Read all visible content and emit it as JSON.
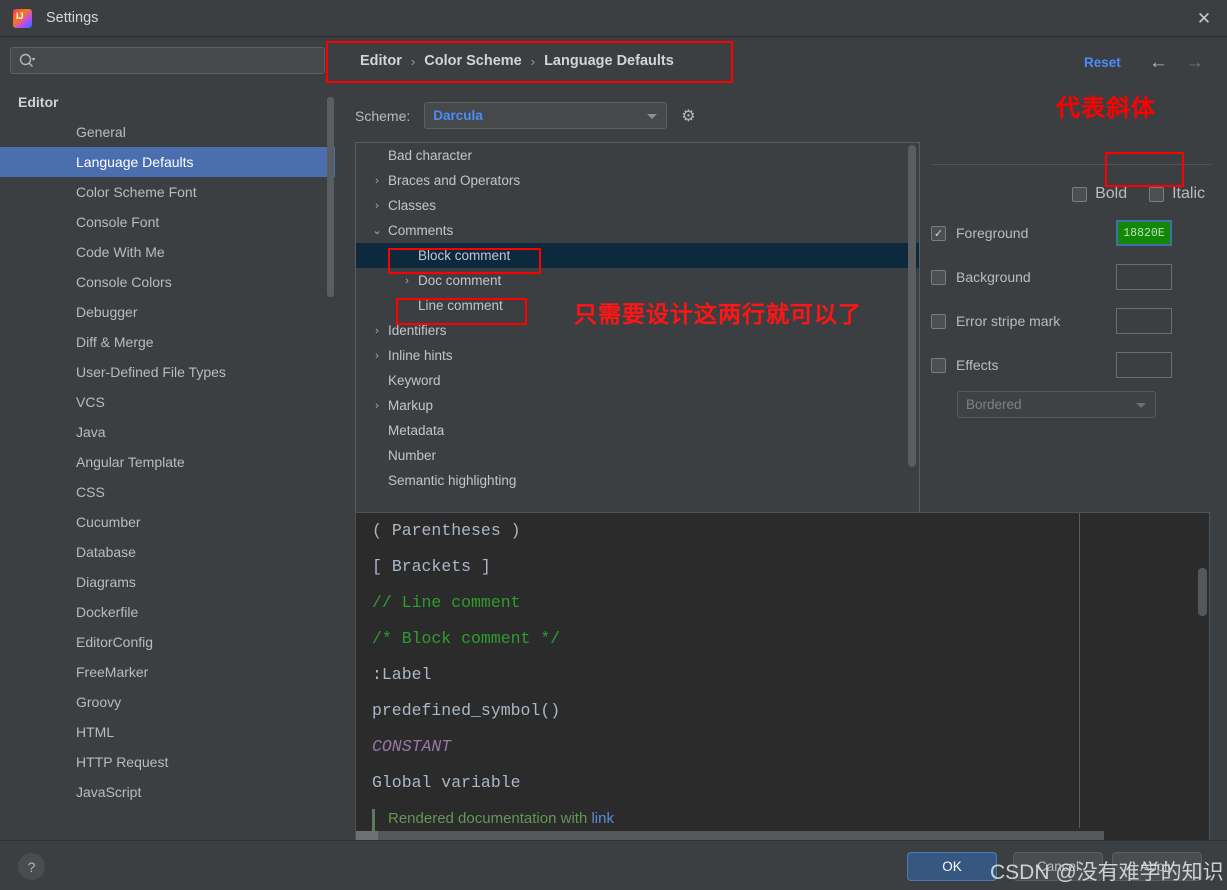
{
  "window": {
    "title": "Settings",
    "logo_icon": "intellij-idea-logo",
    "close_icon": "✕"
  },
  "sidebar": {
    "search": {
      "value": "",
      "placeholder": "",
      "icon": "search-icon"
    },
    "group_label": "Editor",
    "items": [
      {
        "label": "General",
        "selected": false
      },
      {
        "label": "Language Defaults",
        "selected": true
      },
      {
        "label": "Color Scheme Font",
        "selected": false
      },
      {
        "label": "Console Font",
        "selected": false
      },
      {
        "label": "Code With Me",
        "selected": false
      },
      {
        "label": "Console Colors",
        "selected": false
      },
      {
        "label": "Debugger",
        "selected": false
      },
      {
        "label": "Diff & Merge",
        "selected": false
      },
      {
        "label": "User-Defined File Types",
        "selected": false
      },
      {
        "label": "VCS",
        "selected": false
      },
      {
        "label": "Java",
        "selected": false
      },
      {
        "label": "Angular Template",
        "selected": false
      },
      {
        "label": "CSS",
        "selected": false
      },
      {
        "label": "Cucumber",
        "selected": false
      },
      {
        "label": "Database",
        "selected": false
      },
      {
        "label": "Diagrams",
        "selected": false
      },
      {
        "label": "Dockerfile",
        "selected": false
      },
      {
        "label": "EditorConfig",
        "selected": false
      },
      {
        "label": "FreeMarker",
        "selected": false
      },
      {
        "label": "Groovy",
        "selected": false
      },
      {
        "label": "HTML",
        "selected": false
      },
      {
        "label": "HTTP Request",
        "selected": false
      },
      {
        "label": "JavaScript",
        "selected": false
      }
    ]
  },
  "header": {
    "breadcrumb": [
      "Editor",
      "Color Scheme",
      "Language Defaults"
    ],
    "separator": "›",
    "reset_label": "Reset",
    "back_icon": "←",
    "forward_icon": "→"
  },
  "scheme": {
    "label": "Scheme:",
    "value": "Darcula",
    "gear_icon": "⚙",
    "caret_icon": "chevron-down-icon"
  },
  "tree": {
    "rows": [
      {
        "label": "Bad character",
        "indent": 1,
        "toggle": "",
        "selected": false
      },
      {
        "label": "Braces and Operators",
        "indent": 1,
        "toggle": "›",
        "selected": false
      },
      {
        "label": "Classes",
        "indent": 1,
        "toggle": "›",
        "selected": false
      },
      {
        "label": "Comments",
        "indent": 1,
        "toggle": "⌄",
        "selected": false
      },
      {
        "label": "Block comment",
        "indent": 2,
        "toggle": "",
        "selected": true
      },
      {
        "label": "Doc comment",
        "indent": 2,
        "toggle": "›",
        "selected": false
      },
      {
        "label": "Line comment",
        "indent": 2,
        "toggle": "",
        "selected": false
      },
      {
        "label": "Identifiers",
        "indent": 1,
        "toggle": "›",
        "selected": false
      },
      {
        "label": "Inline hints",
        "indent": 1,
        "toggle": "›",
        "selected": false
      },
      {
        "label": "Keyword",
        "indent": 1,
        "toggle": "",
        "selected": false
      },
      {
        "label": "Markup",
        "indent": 1,
        "toggle": "›",
        "selected": false
      },
      {
        "label": "Metadata",
        "indent": 1,
        "toggle": "",
        "selected": false
      },
      {
        "label": "Number",
        "indent": 1,
        "toggle": "",
        "selected": false
      },
      {
        "label": "Semantic highlighting",
        "indent": 1,
        "toggle": "",
        "selected": false
      }
    ]
  },
  "attributes": {
    "bold": {
      "label": "Bold",
      "checked": false
    },
    "italic": {
      "label": "Italic",
      "checked": false
    },
    "foreground": {
      "label": "Foreground",
      "checked": true,
      "color_hex": "18820E",
      "swatch_text": "18820E"
    },
    "background": {
      "label": "Background",
      "checked": false,
      "swatch_text": ""
    },
    "error_stripe": {
      "label": "Error stripe mark",
      "checked": false,
      "swatch_text": ""
    },
    "effects": {
      "label": "Effects",
      "checked": false,
      "swatch_text": ""
    },
    "effects_type": {
      "value": "Bordered",
      "disabled": true
    },
    "check_glyph": "✓"
  },
  "preview": {
    "lines": [
      {
        "parts": [
          {
            "t": "( ",
            "c": ""
          },
          {
            "t": "Parentheses",
            "c": ""
          },
          {
            "t": " )",
            "c": ""
          }
        ]
      },
      {
        "parts": [
          {
            "t": "[ ",
            "c": ""
          },
          {
            "t": "Brackets",
            "c": ""
          },
          {
            "t": " ]",
            "c": ""
          }
        ]
      },
      {
        "parts": [
          {
            "t": "// Line comment",
            "c": "c-comment"
          }
        ]
      },
      {
        "parts": [
          {
            "t": "/* Block comment */",
            "c": "c-comment"
          }
        ]
      },
      {
        "parts": [
          {
            "t": ":Label",
            "c": ""
          }
        ]
      },
      {
        "parts": [
          {
            "t": "predefined_symbol()",
            "c": ""
          }
        ]
      },
      {
        "parts": [
          {
            "t": "CONSTANT",
            "c": "c-const"
          }
        ]
      },
      {
        "parts": [
          {
            "t": "Global variable",
            "c": ""
          }
        ]
      },
      {
        "parts": [
          {
            "t": "Rendered documentation with ",
            "c": "c-doc"
          },
          {
            "t": "link",
            "c": "c-link"
          }
        ]
      }
    ]
  },
  "annotations": {
    "italic_note": "代表斜体",
    "tree_note": "只需要设计这两行就可以了",
    "accent_red": "#ff0000"
  },
  "footer": {
    "help_icon": "?",
    "ok_label": "OK",
    "cancel_label": "Cancel",
    "apply_label": "Apply",
    "watermark": "CSDN @没有难学的知识"
  }
}
